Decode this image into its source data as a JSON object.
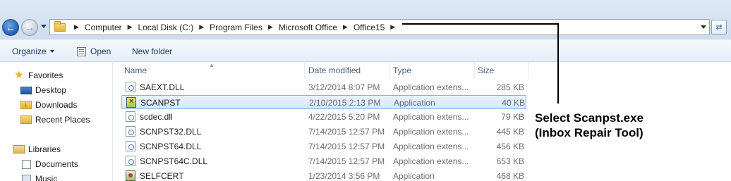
{
  "address_bar": {
    "breadcrumbs": [
      "Computer",
      "Local Disk (C:)",
      "Program Files",
      "Microsoft Office",
      "Office15"
    ]
  },
  "toolbar": {
    "organize_label": "Organize",
    "open_label": "Open",
    "new_folder_label": "New folder"
  },
  "nav_pane": {
    "favorites_label": "Favorites",
    "favorites": [
      "Desktop",
      "Downloads",
      "Recent Places"
    ],
    "libraries_label": "Libraries",
    "libraries": [
      "Documents",
      "Music"
    ]
  },
  "file_list": {
    "columns": [
      "Name",
      "Date modified",
      "Type",
      "Size"
    ],
    "rows": [
      {
        "name": "SAEXT.DLL",
        "date": "3/12/2014 8:07 PM",
        "type": "Application extens...",
        "size": "285 KB",
        "icon": "dll-icon"
      },
      {
        "name": "SCANPST",
        "date": "2/10/2015 2:13 PM",
        "type": "Application",
        "size": "40 KB",
        "icon": "scanpst-app-icon",
        "selected": true
      },
      {
        "name": "scdec.dll",
        "date": "4/22/2015 5:20 PM",
        "type": "Application extens...",
        "size": "79 KB",
        "icon": "dll-icon"
      },
      {
        "name": "SCNPST32.DLL",
        "date": "7/14/2015 12:57 PM",
        "type": "Application extens...",
        "size": "445 KB",
        "icon": "dll-icon"
      },
      {
        "name": "SCNPST64.DLL",
        "date": "7/14/2015 12:57 PM",
        "type": "Application extens...",
        "size": "456 KB",
        "icon": "dll-icon"
      },
      {
        "name": "SCNPST64C.DLL",
        "date": "7/14/2015 12:57 PM",
        "type": "Application extens...",
        "size": "653 KB",
        "icon": "dll-icon"
      },
      {
        "name": "SELFCERT",
        "date": "1/23/2014 3:56 PM",
        "type": "Application",
        "size": "468 KB",
        "icon": "selfcert-app-icon"
      }
    ]
  },
  "annotation": {
    "line1": "Select Scanpst.exe",
    "line2": "(Inbox Repair Tool)"
  }
}
